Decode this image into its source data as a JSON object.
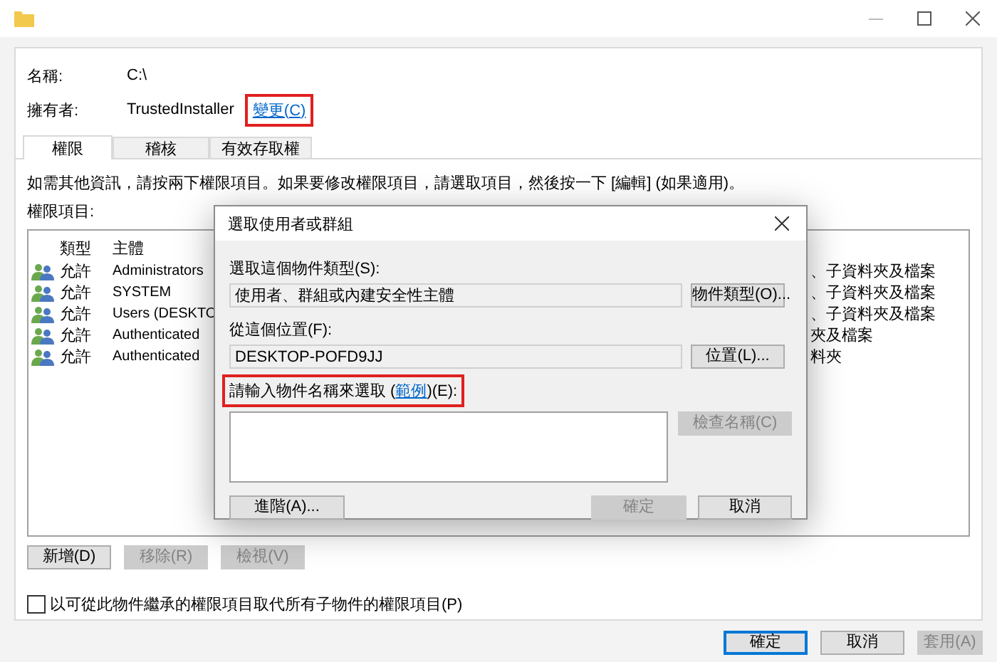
{
  "header": {
    "name_label": "名稱:",
    "name_value": "C:\\",
    "owner_label": "擁有者:",
    "owner_value": "TrustedInstaller",
    "change_link": {
      "label": "變更(C)",
      "highlighted": true
    }
  },
  "tabs": [
    {
      "label": "權限",
      "selected": true
    },
    {
      "label": "稽核",
      "selected": false
    },
    {
      "label": "有效存取權",
      "selected": false
    }
  ],
  "info_text": "如需其他資訊，請按兩下權限項目。如果要修改權限項目，請選取項目，然後按一下 [編輯] (如果適用)。",
  "entries_label": "權限項目:",
  "columns": [
    "類型",
    "主體"
  ],
  "rows": [
    {
      "type": "允許",
      "principal": "Administrators",
      "applies_to": "、子資料夾及檔案"
    },
    {
      "type": "允許",
      "principal": "SYSTEM",
      "applies_to": "、子資料夾及檔案"
    },
    {
      "type": "允許",
      "principal": "Users (DESKTO",
      "applies_to": "、子資料夾及檔案"
    },
    {
      "type": "允許",
      "principal": "Authenticated",
      "applies_to": "夾及檔案"
    },
    {
      "type": "允許",
      "principal": "Authenticated",
      "applies_to": "料夾"
    }
  ],
  "list_buttons": [
    {
      "label": "新增(D)",
      "disabled": false
    },
    {
      "label": "移除(R)",
      "disabled": true
    },
    {
      "label": "檢視(V)",
      "disabled": true
    }
  ],
  "replace_checkbox": {
    "label": "以可從此物件繼承的權限項目取代所有子物件的權限項目(P)",
    "checked": false
  },
  "footer_buttons": [
    {
      "label": "確定",
      "disabled": false,
      "default": true
    },
    {
      "label": "取消",
      "disabled": false,
      "default": false
    },
    {
      "label": "套用(A)",
      "disabled": true,
      "default": false
    }
  ],
  "dialog": {
    "title": "選取使用者或群組",
    "object_type_label": "選取這個物件類型(S):",
    "object_type_value": "使用者、群組或內建安全性主體",
    "object_type_button": "物件類型(O)...",
    "location_label": "從這個位置(F):",
    "location_value": "DESKTOP-POFD9JJ",
    "location_button": "位置(L)...",
    "names_label": {
      "prefix": "請輸入物件名稱來選取 (",
      "link": "範例",
      "suffix": ")(E):",
      "highlighted": true
    },
    "check_names_button": {
      "label": "檢查名稱(C)",
      "disabled": true
    },
    "advanced_button": {
      "label": "進階(A)...",
      "disabled": false
    },
    "ok_button": {
      "label": "確定",
      "disabled": true
    },
    "cancel_button": {
      "label": "取消",
      "disabled": false
    }
  }
}
